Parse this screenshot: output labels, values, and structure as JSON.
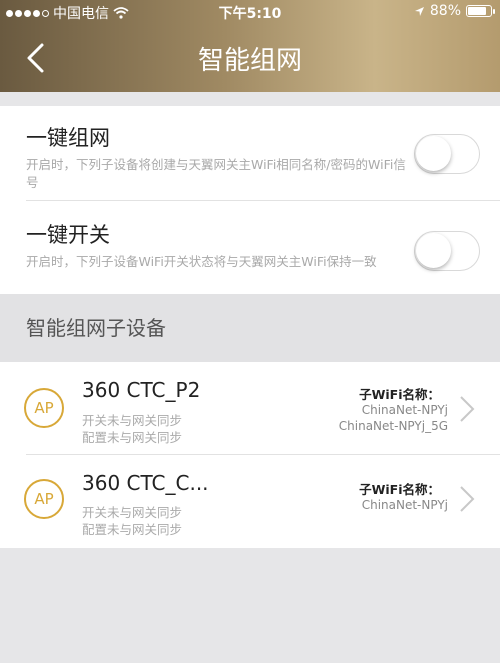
{
  "status_bar": {
    "carrier": "中国电信",
    "time": "下午5:10",
    "battery": "88%",
    "battery_level": 0.88,
    "icons": [
      "signal-icon",
      "wifi-icon",
      "location-arrow-icon",
      "battery-icon"
    ]
  },
  "nav": {
    "title": "智能组网",
    "back_icon": "back-chevron-icon"
  },
  "toggles": [
    {
      "title": "一键组网",
      "desc": "开启时，下列子设备将创建与天翼网关主WiFi相同名称/密码的WiFi信号",
      "on": false
    },
    {
      "title": "一键开关",
      "desc": "开启时，下列子设备WiFi开关状态将与天翼网关主WiFi保持一致",
      "on": false
    }
  ],
  "section": {
    "title": "智能组网子设备"
  },
  "devices": [
    {
      "badge": "AP",
      "name": "360 CTC_P2",
      "status1": "开关未与网关同步",
      "status2": "配置未与网关同步",
      "wifi_label": "子WiFi名称：",
      "wifi_names": [
        "ChinaNet-NPYj",
        "ChinaNet-NPYj_5G"
      ]
    },
    {
      "badge": "AP",
      "name": "360 CTC_C...",
      "status1": "开关未与网关同步",
      "status2": "配置未与网关同步",
      "wifi_label": "子WiFi名称：",
      "wifi_names": [
        "ChinaNet-NPYj"
      ]
    }
  ],
  "colors": {
    "accent_gold": "#d8a838",
    "header_gradient_start": "#6a5a40",
    "header_gradient_end": "#c9b489"
  }
}
